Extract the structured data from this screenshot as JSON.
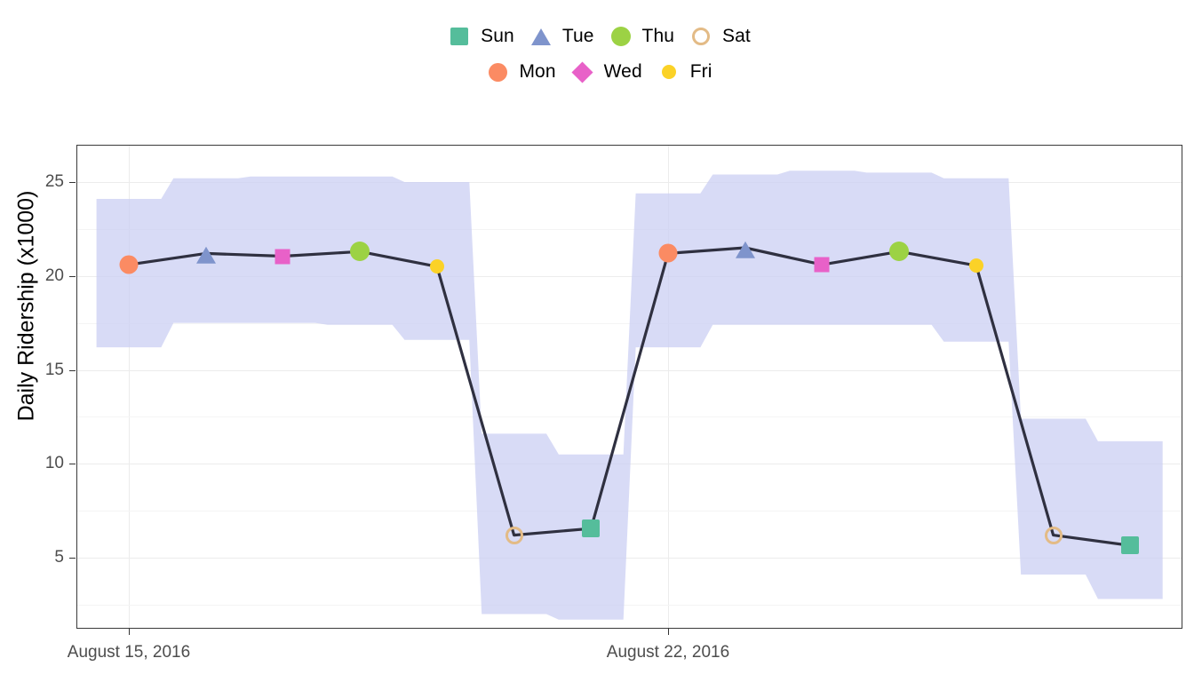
{
  "chart_data": {
    "type": "line",
    "title": "",
    "xlabel": "",
    "ylabel": "Daily Ridership (x1000)",
    "ylim": [
      1.5,
      26.8
    ],
    "xlim": [
      "2016-08-14",
      "2016-08-28"
    ],
    "grid": true,
    "legend_position": "top",
    "y_ticks": [
      5,
      10,
      15,
      20,
      25
    ],
    "y_tick_labels": [
      "5",
      "10",
      "15",
      "20",
      "25"
    ],
    "x_ticks": [
      "August 15, 2016",
      "August 22, 2016"
    ],
    "series": [
      {
        "name": "Daily Ridership",
        "line_color": "#2f3040",
        "ribbon_color": "#c9cdf2",
        "ribbon_label": "confidence interval",
        "points": [
          {
            "day": "Mon",
            "date": "August 15, 2016",
            "value": 20.6,
            "lower": 16.2,
            "upper": 24.1
          },
          {
            "day": "Tue",
            "date": "August 16, 2016",
            "value": 21.2,
            "lower": 17.5,
            "upper": 25.2
          },
          {
            "day": "Wed",
            "date": "August 17, 2016",
            "value": 21.05,
            "lower": 17.5,
            "upper": 25.3
          },
          {
            "day": "Thu",
            "date": "August 18, 2016",
            "value": 21.3,
            "lower": 17.4,
            "upper": 25.3
          },
          {
            "day": "Fri",
            "date": "August 19, 2016",
            "value": 20.5,
            "lower": 16.6,
            "upper": 25.0
          },
          {
            "day": "Sat",
            "date": "August 20, 2016",
            "value": 6.2,
            "lower": 2.0,
            "upper": 11.6
          },
          {
            "day": "Sun",
            "date": "August 21, 2016",
            "value": 6.55,
            "lower": 1.7,
            "upper": 10.5
          },
          {
            "day": "Mon",
            "date": "August 22, 2016",
            "value": 21.2,
            "lower": 16.2,
            "upper": 24.4
          },
          {
            "day": "Tue",
            "date": "August 23, 2016",
            "value": 21.5,
            "lower": 17.4,
            "upper": 25.4
          },
          {
            "day": "Wed",
            "date": "August 24, 2016",
            "value": 20.6,
            "lower": 17.4,
            "upper": 25.6
          },
          {
            "day": "Thu",
            "date": "August 25, 2016",
            "value": 21.3,
            "lower": 17.4,
            "upper": 25.5
          },
          {
            "day": "Fri",
            "date": "August 26, 2016",
            "value": 20.55,
            "lower": 16.5,
            "upper": 25.2
          },
          {
            "day": "Sat",
            "date": "August 27, 2016",
            "value": 6.2,
            "lower": 4.1,
            "upper": 12.4
          },
          {
            "day": "Sun",
            "date": "August 28, 2016",
            "value": 5.65,
            "lower": 2.8,
            "upper": 11.2
          }
        ]
      }
    ]
  },
  "legend": {
    "rows": [
      [
        {
          "label": "Sun",
          "shape": "square",
          "color": "#55bd9b",
          "size": 20,
          "filled": true
        },
        {
          "label": "Tue",
          "shape": "triangle",
          "color": "#7f94cc",
          "size": 22,
          "filled": true
        },
        {
          "label": "Thu",
          "shape": "circle",
          "color": "#9cd244",
          "size": 22,
          "filled": true
        },
        {
          "label": "Sat",
          "shape": "open-circle",
          "color": "#e3bb86",
          "size": 20,
          "filled": false
        }
      ],
      [
        {
          "label": "Mon",
          "shape": "circle",
          "color": "#fb8b63",
          "size": 21,
          "filled": true
        },
        {
          "label": "Wed",
          "shape": "diamond",
          "color": "#e861c8",
          "size": 17,
          "filled": true
        },
        {
          "label": "Fri",
          "shape": "circle",
          "color": "#fbd227",
          "size": 16,
          "filled": true
        }
      ]
    ]
  },
  "axis": {
    "y_title": "Daily Ridership (x1000)",
    "y_labels": [
      "25",
      "20",
      "15",
      "10",
      "5"
    ],
    "x_labels": [
      "August 15, 2016",
      "August 22, 2016"
    ]
  },
  "colors": {
    "sun": "#55bd9b",
    "mon": "#fb8b63",
    "tue": "#7f94cc",
    "wed": "#e861c8",
    "thu": "#9cd244",
    "fri": "#fbd227",
    "sat": "#e3bb86",
    "line": "#2f3040",
    "ribbon": "#c9cdf2",
    "grid": "#ececec",
    "panel_border": "#3a3a3a",
    "tick_text": "#4d4d4d"
  }
}
